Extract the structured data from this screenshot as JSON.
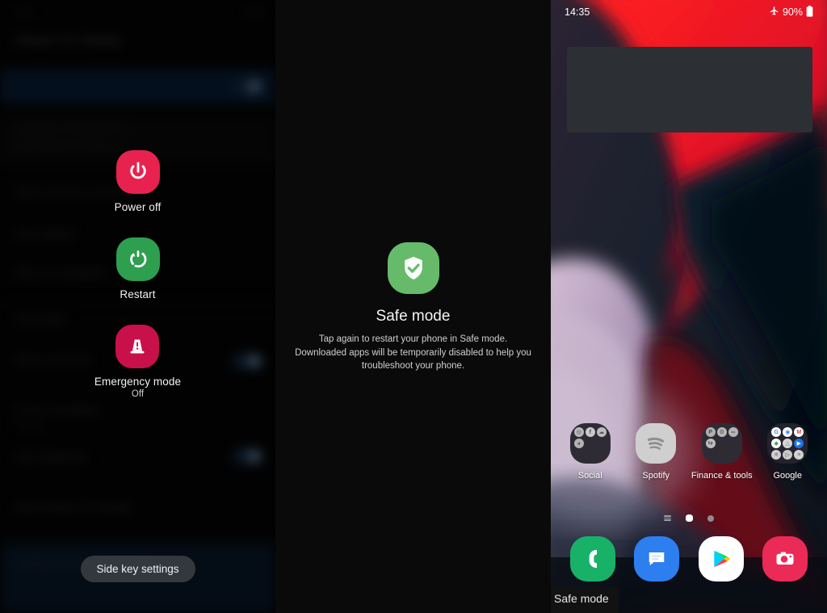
{
  "panels": {
    "left": {
      "name": "power-menu-over-settings",
      "background_settings": {
        "status_time": "3:46",
        "status_right": "90%",
        "screen_title": "Always On Display",
        "rows": [
          "Tap to show for 10 seconds",
          "Show always",
          "Show as scheduled",
          "Clock style",
          "Show music info",
          "Screen orientation",
          "Portrait",
          "Auto brightness",
          "About Always On Display",
          "Looking for something else?"
        ]
      },
      "menu": {
        "items": [
          {
            "icon": "power-off-icon",
            "label": "Power off",
            "sub": "",
            "color": "#e8224e"
          },
          {
            "icon": "restart-icon",
            "label": "Restart",
            "sub": "",
            "color": "#2e9e4f"
          },
          {
            "icon": "emergency-mode-icon",
            "label": "Emergency mode",
            "sub": "Off",
            "color": "#c8104b"
          }
        ],
        "side_key_button": "Side key settings"
      }
    },
    "middle": {
      "name": "safe-mode-confirmation",
      "icon": "shield-check-icon",
      "icon_color": "#66bb6a",
      "title": "Safe mode",
      "description": "Tap again to restart your phone in Safe mode. Downloaded apps will be temporarily disabled to help you troubleshoot your phone."
    },
    "right": {
      "name": "home-screen-safe-mode",
      "statusbar": {
        "time": "14:35",
        "airplane_icon": "airplane-mode-icon",
        "battery_percent": "90%",
        "battery_icon": "battery-icon"
      },
      "widget": {
        "name": "blank-widget"
      },
      "folders": [
        {
          "label": "Social",
          "type": "folder",
          "apps": [
            {
              "name": "instagram",
              "glyph": "◎",
              "bg": "#b9b9b9",
              "fg": "#555"
            },
            {
              "name": "facebook",
              "glyph": "f",
              "bg": "#c9c9c9",
              "fg": "#4a4a4a"
            },
            {
              "name": "snapchat",
              "glyph": "☁",
              "bg": "#bdbdbd",
              "fg": "#555"
            },
            {
              "name": "reddit",
              "glyph": "◕",
              "bg": "#b3b3b3",
              "fg": "#4a4a4a"
            }
          ]
        },
        {
          "label": "Spotify",
          "type": "app",
          "icon": "spotify-icon",
          "bg": "#c8c8c8",
          "fg": "#8f8f8f"
        },
        {
          "label": "Finance & tools",
          "type": "folder",
          "apps": [
            {
              "name": "paypal",
              "glyph": "P",
              "bg": "#b0b0b0",
              "fg": "#4a4a4a"
            },
            {
              "name": "settings",
              "glyph": "⚙",
              "bg": "#b8b8b8",
              "fg": "#505050"
            },
            {
              "name": "bank",
              "glyph": "═",
              "bg": "#b5b5b5",
              "fg": "#4f4f4f"
            },
            {
              "name": "keepass",
              "glyph": "kp",
              "bg": "#bcbcbc",
              "fg": "#4a4a4a"
            }
          ]
        },
        {
          "label": "Google",
          "type": "folder",
          "apps": [
            {
              "name": "google",
              "glyph": "G",
              "bg": "#ffffff",
              "fg": "#4285f4"
            },
            {
              "name": "chrome",
              "glyph": "◉",
              "bg": "#ffffff",
              "fg": "#4285f4"
            },
            {
              "name": "gmail",
              "glyph": "M",
              "bg": "#ffffff",
              "fg": "#ea4335"
            },
            {
              "name": "maps",
              "glyph": "◆",
              "bg": "#ffffff",
              "fg": "#34a853"
            },
            {
              "name": "drive",
              "glyph": "△",
              "bg": "#d6d6d6",
              "fg": "#777"
            },
            {
              "name": "meet",
              "glyph": "▶",
              "bg": "#1a73e8",
              "fg": "#ffffff"
            },
            {
              "name": "photos",
              "glyph": "✵",
              "bg": "#cfcfcf",
              "fg": "#777"
            },
            {
              "name": "play-movies",
              "glyph": "▷",
              "bg": "#c9c9c9",
              "fg": "#666"
            },
            {
              "name": "docs",
              "glyph": "≡",
              "bg": "#d2d2d2",
              "fg": "#6e6e6e"
            }
          ]
        }
      ],
      "page_indicators": [
        {
          "name": "app-list-indicator",
          "type": "lines",
          "active": false
        },
        {
          "name": "home-page-indicator",
          "type": "home",
          "active": true
        },
        {
          "name": "second-page-indicator",
          "type": "dot",
          "active": false
        }
      ],
      "dock": [
        {
          "label": "Phone",
          "icon": "phone-icon",
          "bg": "#17b268"
        },
        {
          "label": "Messages",
          "icon": "messages-icon",
          "bg": "#2d7ff0"
        },
        {
          "label": "Play Store",
          "icon": "play-store-icon",
          "bg": "#ffffff"
        },
        {
          "label": "Camera",
          "icon": "camera-icon",
          "bg": "#ec2a57"
        }
      ],
      "safe_mode_badge": "Safe mode"
    }
  },
  "colors": {
    "power_off_red": "#e8224e",
    "restart_green": "#2e9e4f",
    "emergency_crimson": "#c8104b",
    "safe_mode_green": "#66bb6a",
    "accent_blue": "#2d7ff0"
  }
}
